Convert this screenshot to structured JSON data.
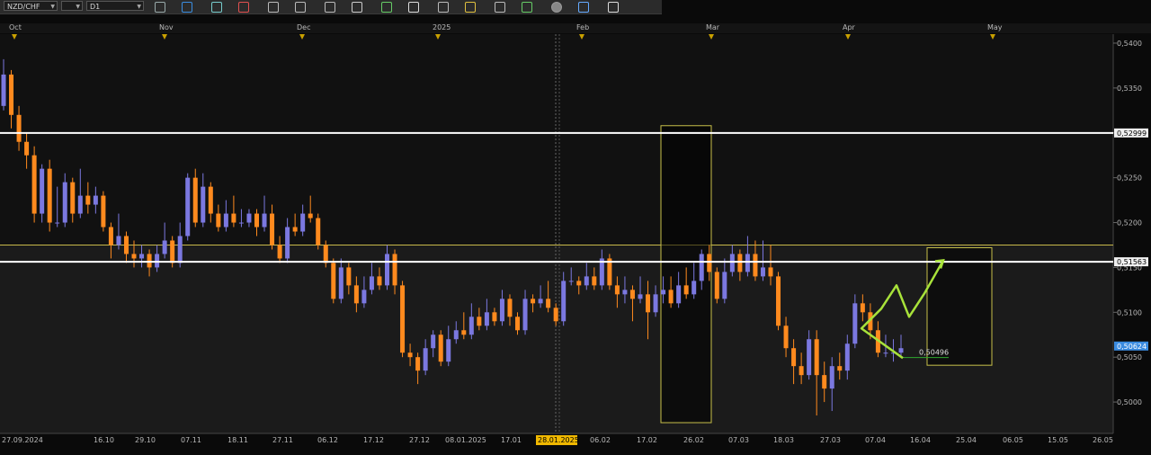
{
  "toolbar": {
    "symbol": "NZD/CHF",
    "period": "D1",
    "icons": [
      "chart-type-icon",
      "crosshair-icon",
      "line-icon",
      "rectangle-icon",
      "zoom-in-icon",
      "zoom-out-icon",
      "fit-icon",
      "text-icon",
      "save-icon",
      "settings-icon",
      "pen-icon",
      "arrow-icon",
      "fib-icon",
      "channel-icon",
      "circle-icon",
      "marker-icon",
      "eraser-icon"
    ]
  },
  "colors": {
    "bull": "#7b78e0",
    "bear": "#ff8a1e",
    "background_upper": "#111111",
    "background_lower": "#1b1b1b",
    "level_line": "#ffffff",
    "yellow_line": "#c8b84a",
    "yellow_box": "#c8c04a",
    "forecast_arrow": "#a8e23a",
    "target_line": "#2fa82f",
    "price_tag": "#3a8be0",
    "date_tag": "#f0b800"
  },
  "chart_data": {
    "type": "candlestick",
    "symbol": "NZD/CHF",
    "timeframe": "D1",
    "ylim": [
      0.4965,
      0.541
    ],
    "y_ticks": [
      "0,5400",
      "0,5350",
      "0,5300",
      "0,5250",
      "0,5200",
      "0,5150",
      "0,5100",
      "0,5050",
      "0,5000"
    ],
    "month_labels": [
      "Oct",
      "Nov",
      "Dec",
      "2025",
      "Feb",
      "Mar",
      "Apr",
      "May"
    ],
    "x_tick_labels": [
      "27.09.2024",
      "16.10",
      "29.10",
      "07.11",
      "18.11",
      "27.11",
      "06.12",
      "17.12",
      "27.12",
      "08.01.2025",
      "17.01",
      "28.01.2025",
      "06.02",
      "17.02",
      "26.02",
      "07.03",
      "18.03",
      "27.03",
      "07.04",
      "16.04",
      "25.04",
      "06.05",
      "15.05",
      "26.05"
    ],
    "highlighted_date": "28.01.2025",
    "levels": [
      {
        "label": "0,52999",
        "price": 0.52999,
        "color": "white"
      },
      {
        "label": "0,51563",
        "price": 0.51563,
        "color": "white"
      }
    ],
    "yellow_level": 0.5175,
    "current_price": {
      "label": "0,50624",
      "price": 0.50624
    },
    "target_price": {
      "label": "0,50496",
      "price": 0.50496
    },
    "highlight_zone": {
      "from_date": "18.02",
      "to_date": "26.02",
      "low": 0.4977,
      "high": 0.5308
    },
    "target_zone": {
      "from_date": "16.04",
      "to_date": "25.04",
      "low": 0.5041,
      "high": 0.5172
    },
    "forecast_path": [
      0.5049,
      0.5082,
      0.5104,
      0.513,
      0.5095,
      0.5121,
      0.5158
    ],
    "candles": [
      [
        0.533,
        0.5365,
        0.5382,
        0.5325
      ],
      [
        0.5365,
        0.532,
        0.537,
        0.5305
      ],
      [
        0.532,
        0.529,
        0.533,
        0.528
      ],
      [
        0.529,
        0.5275,
        0.53,
        0.526
      ],
      [
        0.5275,
        0.521,
        0.5285,
        0.52
      ],
      [
        0.521,
        0.526,
        0.5265,
        0.52
      ],
      [
        0.526,
        0.52,
        0.527,
        0.519
      ],
      [
        0.52,
        0.52,
        0.524,
        0.5195
      ],
      [
        0.52,
        0.5245,
        0.5255,
        0.5195
      ],
      [
        0.5245,
        0.521,
        0.525,
        0.52
      ],
      [
        0.521,
        0.523,
        0.526,
        0.5205
      ],
      [
        0.523,
        0.522,
        0.5245,
        0.521
      ],
      [
        0.522,
        0.523,
        0.524,
        0.521
      ],
      [
        0.523,
        0.5195,
        0.5235,
        0.519
      ],
      [
        0.5195,
        0.5175,
        0.52,
        0.516
      ],
      [
        0.5175,
        0.5185,
        0.521,
        0.517
      ],
      [
        0.5185,
        0.5165,
        0.519,
        0.5155
      ],
      [
        0.5165,
        0.516,
        0.518,
        0.515
      ],
      [
        0.516,
        0.5165,
        0.5175,
        0.515
      ],
      [
        0.5165,
        0.515,
        0.517,
        0.514
      ],
      [
        0.515,
        0.5165,
        0.5175,
        0.5145
      ],
      [
        0.5165,
        0.518,
        0.52,
        0.516
      ],
      [
        0.518,
        0.5155,
        0.5185,
        0.515
      ],
      [
        0.5155,
        0.5185,
        0.52,
        0.515
      ],
      [
        0.5185,
        0.525,
        0.5255,
        0.518
      ],
      [
        0.525,
        0.52,
        0.526,
        0.5195
      ],
      [
        0.52,
        0.524,
        0.5255,
        0.5195
      ],
      [
        0.524,
        0.521,
        0.5245,
        0.52
      ],
      [
        0.521,
        0.5195,
        0.522,
        0.519
      ],
      [
        0.5195,
        0.521,
        0.5225,
        0.519
      ],
      [
        0.521,
        0.52,
        0.523,
        0.5195
      ],
      [
        0.52,
        0.52,
        0.5215,
        0.5195
      ],
      [
        0.52,
        0.521,
        0.5215,
        0.5195
      ],
      [
        0.521,
        0.5195,
        0.5215,
        0.5185
      ],
      [
        0.5195,
        0.521,
        0.523,
        0.519
      ],
      [
        0.521,
        0.5175,
        0.522,
        0.517
      ],
      [
        0.5175,
        0.516,
        0.5185,
        0.5155
      ],
      [
        0.516,
        0.5195,
        0.5205,
        0.5155
      ],
      [
        0.5195,
        0.519,
        0.521,
        0.5185
      ],
      [
        0.519,
        0.521,
        0.522,
        0.5185
      ],
      [
        0.521,
        0.5205,
        0.523,
        0.52
      ],
      [
        0.5205,
        0.5175,
        0.521,
        0.517
      ],
      [
        0.5175,
        0.5155,
        0.518,
        0.515
      ],
      [
        0.5155,
        0.5115,
        0.516,
        0.511
      ],
      [
        0.5115,
        0.515,
        0.516,
        0.511
      ],
      [
        0.515,
        0.513,
        0.5155,
        0.512
      ],
      [
        0.513,
        0.511,
        0.514,
        0.51
      ],
      [
        0.511,
        0.5125,
        0.514,
        0.5105
      ],
      [
        0.5125,
        0.514,
        0.5155,
        0.512
      ],
      [
        0.514,
        0.513,
        0.515,
        0.5125
      ],
      [
        0.513,
        0.5165,
        0.5175,
        0.5125
      ],
      [
        0.5165,
        0.513,
        0.517,
        0.512
      ],
      [
        0.513,
        0.5055,
        0.5135,
        0.505
      ],
      [
        0.5055,
        0.505,
        0.5065,
        0.504
      ],
      [
        0.505,
        0.5035,
        0.5055,
        0.502
      ],
      [
        0.5035,
        0.506,
        0.507,
        0.503
      ],
      [
        0.506,
        0.5075,
        0.508,
        0.505
      ],
      [
        0.5075,
        0.5045,
        0.508,
        0.504
      ],
      [
        0.5045,
        0.507,
        0.5085,
        0.504
      ],
      [
        0.507,
        0.508,
        0.509,
        0.5065
      ],
      [
        0.508,
        0.5075,
        0.51,
        0.507
      ],
      [
        0.5075,
        0.5095,
        0.511,
        0.507
      ],
      [
        0.5095,
        0.5085,
        0.5105,
        0.508
      ],
      [
        0.5085,
        0.51,
        0.5115,
        0.508
      ],
      [
        0.51,
        0.509,
        0.5105,
        0.5085
      ],
      [
        0.509,
        0.5115,
        0.5125,
        0.5085
      ],
      [
        0.5115,
        0.5095,
        0.512,
        0.5085
      ],
      [
        0.5095,
        0.508,
        0.51,
        0.5075
      ],
      [
        0.508,
        0.5115,
        0.5125,
        0.5075
      ],
      [
        0.5115,
        0.511,
        0.512,
        0.51
      ],
      [
        0.511,
        0.5115,
        0.513,
        0.5105
      ],
      [
        0.5115,
        0.5105,
        0.5135,
        0.51
      ],
      [
        0.5105,
        0.509,
        0.511,
        0.5085
      ],
      [
        0.509,
        0.5135,
        0.5145,
        0.5085
      ],
      [
        0.5135,
        0.5135,
        0.515,
        0.513
      ],
      [
        0.5135,
        0.513,
        0.514,
        0.512
      ],
      [
        0.513,
        0.514,
        0.5155,
        0.5125
      ],
      [
        0.514,
        0.513,
        0.515,
        0.5125
      ],
      [
        0.513,
        0.516,
        0.517,
        0.5125
      ],
      [
        0.516,
        0.513,
        0.5165,
        0.5125
      ],
      [
        0.513,
        0.512,
        0.514,
        0.5105
      ],
      [
        0.512,
        0.5125,
        0.514,
        0.511
      ],
      [
        0.5125,
        0.5115,
        0.513,
        0.509
      ],
      [
        0.5115,
        0.512,
        0.514,
        0.511
      ],
      [
        0.512,
        0.51,
        0.5135,
        0.507
      ],
      [
        0.51,
        0.512,
        0.513,
        0.5095
      ],
      [
        0.512,
        0.5125,
        0.514,
        0.511
      ],
      [
        0.5125,
        0.511,
        0.514,
        0.5105
      ],
      [
        0.511,
        0.513,
        0.5145,
        0.5105
      ],
      [
        0.513,
        0.512,
        0.515,
        0.5115
      ],
      [
        0.512,
        0.5135,
        0.5155,
        0.5115
      ],
      [
        0.5135,
        0.5165,
        0.517,
        0.5125
      ],
      [
        0.5165,
        0.5145,
        0.5175,
        0.5135
      ],
      [
        0.5145,
        0.5115,
        0.515,
        0.511
      ],
      [
        0.5115,
        0.5145,
        0.516,
        0.511
      ],
      [
        0.5145,
        0.5165,
        0.5175,
        0.514
      ],
      [
        0.5165,
        0.5145,
        0.517,
        0.5135
      ],
      [
        0.5145,
        0.5165,
        0.5185,
        0.514
      ],
      [
        0.5165,
        0.514,
        0.518,
        0.5135
      ],
      [
        0.514,
        0.515,
        0.518,
        0.5135
      ],
      [
        0.515,
        0.514,
        0.5175,
        0.513
      ],
      [
        0.514,
        0.5085,
        0.5145,
        0.508
      ],
      [
        0.5085,
        0.506,
        0.5095,
        0.505
      ],
      [
        0.506,
        0.504,
        0.507,
        0.502
      ],
      [
        0.504,
        0.503,
        0.5055,
        0.502
      ],
      [
        0.503,
        0.507,
        0.508,
        0.5025
      ],
      [
        0.507,
        0.503,
        0.508,
        0.4985
      ],
      [
        0.503,
        0.5015,
        0.5045,
        0.5
      ],
      [
        0.5015,
        0.504,
        0.505,
        0.499
      ],
      [
        0.504,
        0.5035,
        0.5055,
        0.5025
      ],
      [
        0.5035,
        0.5065,
        0.5075,
        0.5025
      ],
      [
        0.5065,
        0.511,
        0.512,
        0.506
      ],
      [
        0.511,
        0.51,
        0.512,
        0.509
      ],
      [
        0.51,
        0.508,
        0.511,
        0.507
      ],
      [
        0.508,
        0.5055,
        0.509,
        0.505
      ],
      [
        0.5055,
        0.5055,
        0.5075,
        0.505
      ],
      [
        0.5055,
        0.5055,
        0.507,
        0.5045
      ],
      [
        0.5055,
        0.506,
        0.5075,
        0.505
      ]
    ]
  }
}
